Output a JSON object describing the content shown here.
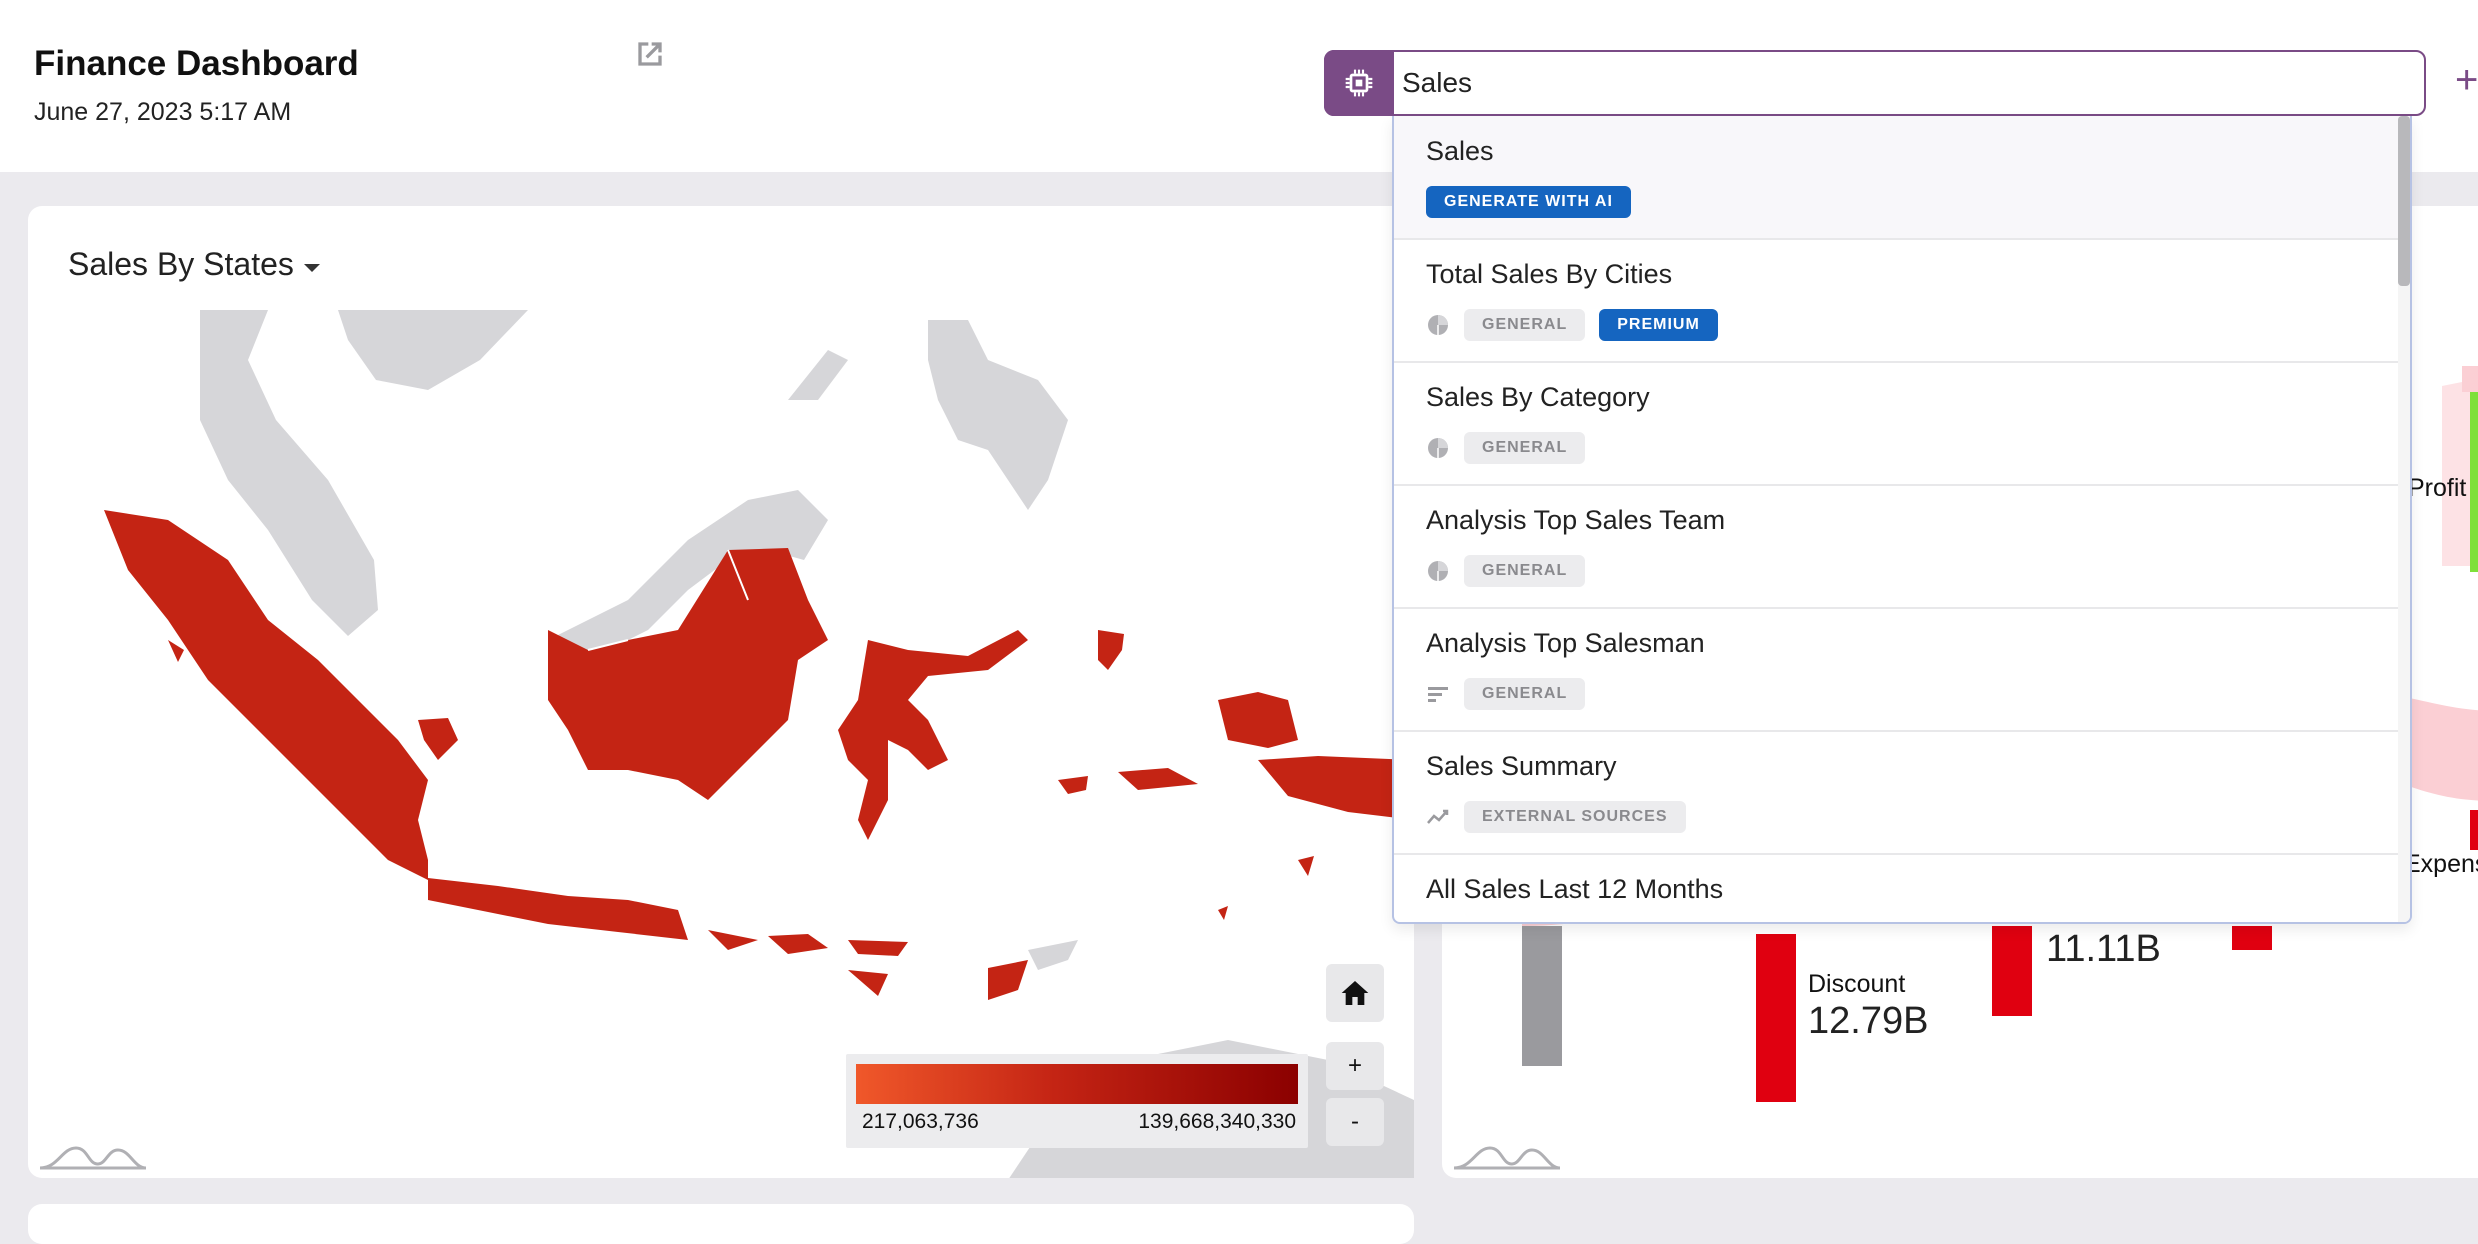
{
  "header": {
    "title": "Finance Dashboard",
    "date": "June 27, 2023 5:17 AM"
  },
  "search": {
    "value": "Sales",
    "placeholder": ""
  },
  "map_card": {
    "title": "Sales By States",
    "legend_min": "217,063,736",
    "legend_max": "139,668,340,330",
    "zoom_in": "+",
    "zoom_out": "-",
    "colors": {
      "low": "#f0582a",
      "mid": "#c42414",
      "high": "#8b0000",
      "no_data": "#d6d6d9"
    }
  },
  "sankey": {
    "profit_label": "Profit",
    "expense_label": "Expens",
    "discount_label": "Discount",
    "discount_value": "12.79B",
    "other_value": "11.11B"
  },
  "dropdown": {
    "items": [
      {
        "title": "Sales",
        "icon": "",
        "tags": [
          {
            "text": "GENERATE WITH AI",
            "style": "blue"
          }
        ]
      },
      {
        "title": "Total Sales By Cities",
        "icon": "pie-chart-icon",
        "tags": [
          {
            "text": "GENERAL",
            "style": "gray"
          },
          {
            "text": "PREMIUM",
            "style": "blue"
          }
        ]
      },
      {
        "title": "Sales By Category",
        "icon": "pie-chart-icon",
        "tags": [
          {
            "text": "GENERAL",
            "style": "gray"
          }
        ]
      },
      {
        "title": "Analysis Top Sales Team",
        "icon": "pie-chart-icon",
        "tags": [
          {
            "text": "GENERAL",
            "style": "gray"
          }
        ]
      },
      {
        "title": "Analysis Top Salesman",
        "icon": "bar-list-icon",
        "tags": [
          {
            "text": "GENERAL",
            "style": "gray"
          }
        ]
      },
      {
        "title": "Sales Summary",
        "icon": "trend-line-icon",
        "tags": [
          {
            "text": "EXTERNAL SOURCES",
            "style": "gray"
          }
        ]
      },
      {
        "title": "All Sales Last 12 Months",
        "icon": "",
        "tags": []
      }
    ]
  }
}
